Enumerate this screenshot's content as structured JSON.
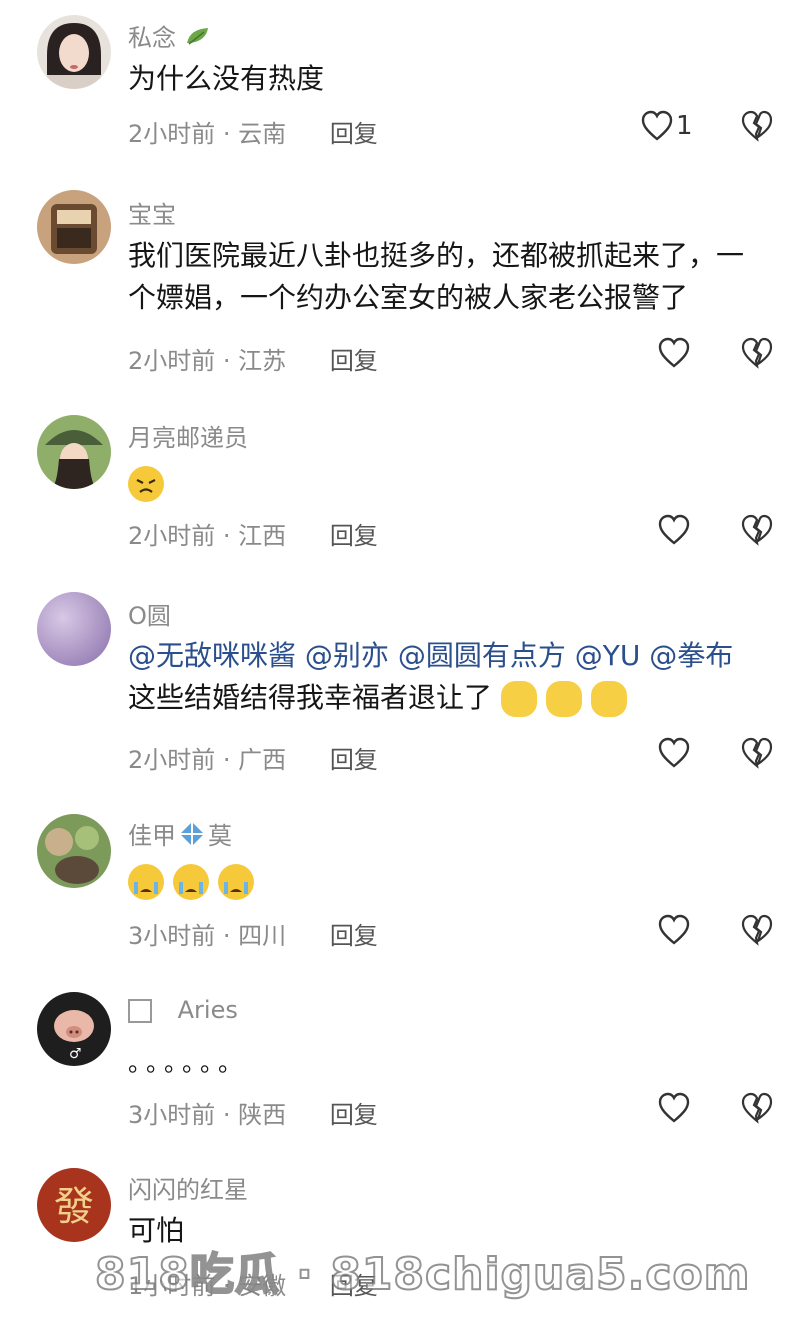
{
  "comments": [
    {
      "user": "私念",
      "text": "为什么没有热度",
      "time": "2小时前",
      "region": "云南",
      "reply": "回复",
      "likes": "1"
    },
    {
      "user": "宝宝",
      "text": "我们医院最近八卦也挺多的，还都被抓起来了，一个嫖娼，一个约办公室女的被人家老公报警了",
      "time": "2小时前",
      "region": "江苏",
      "reply": "回复",
      "likes": ""
    },
    {
      "user": "月亮邮递员",
      "text": "",
      "time": "2小时前",
      "region": "江西",
      "reply": "回复",
      "likes": ""
    },
    {
      "user": "O圆",
      "mentions": [
        "@无敌咪咪酱",
        "@别亦",
        "@圆圆有点方",
        "@YU",
        "@拳布"
      ],
      "text": "这些结婚结得我幸福者退让了",
      "time": "2小时前",
      "region": "广西",
      "reply": "回复",
      "likes": ""
    },
    {
      "user": "佳甲",
      "user_suffix": "莫",
      "text": "",
      "time": "3小时前",
      "region": "四川",
      "reply": "回复",
      "likes": ""
    },
    {
      "user": "Aries",
      "text": "。。。。。。",
      "time": "3小时前",
      "region": "陕西",
      "reply": "回复",
      "likes": ""
    },
    {
      "user": "闪闪的红星",
      "text": "可怕",
      "time": "1小时前",
      "region": "安徽",
      "reply": "回复",
      "likes": ""
    }
  ],
  "watermark": "818吃瓜 · 818chigua5.com",
  "icons": {
    "like": "heart-outline-icon",
    "dislike": "broken-heart-icon"
  }
}
